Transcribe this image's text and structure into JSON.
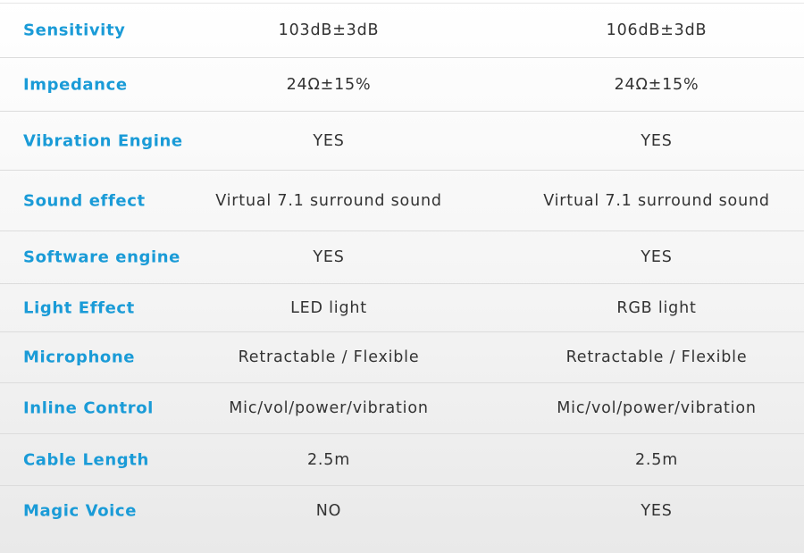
{
  "colors": {
    "label": "#1a9bd7",
    "value": "#333333",
    "divider": "#dcdcdc"
  },
  "rows": [
    {
      "label": "Sensitivity",
      "value_1": "103dB±3dB",
      "value_2": "106dB±3dB"
    },
    {
      "label": "Impedance",
      "value_1": "24Ω±15%",
      "value_2": "24Ω±15%"
    },
    {
      "label": "Vibration Engine",
      "value_1": "YES",
      "value_2": "YES"
    },
    {
      "label": "Sound effect",
      "value_1": "Virtual 7.1 surround sound",
      "value_2": "Virtual 7.1 surround sound"
    },
    {
      "label": "Software engine",
      "value_1": "YES",
      "value_2": "YES"
    },
    {
      "label": "Light Effect",
      "value_1": "LED light",
      "value_2": "RGB light"
    },
    {
      "label": "Microphone",
      "value_1": "Retractable / Flexible",
      "value_2": "Retractable / Flexible"
    },
    {
      "label": "Inline Control",
      "value_1": "Mic/vol/power/vibration",
      "value_2": "Mic/vol/power/vibration"
    },
    {
      "label": "Cable Length",
      "value_1": "2.5m",
      "value_2": "2.5m"
    },
    {
      "label": "Magic Voice",
      "value_1": "NO",
      "value_2": "YES"
    }
  ]
}
